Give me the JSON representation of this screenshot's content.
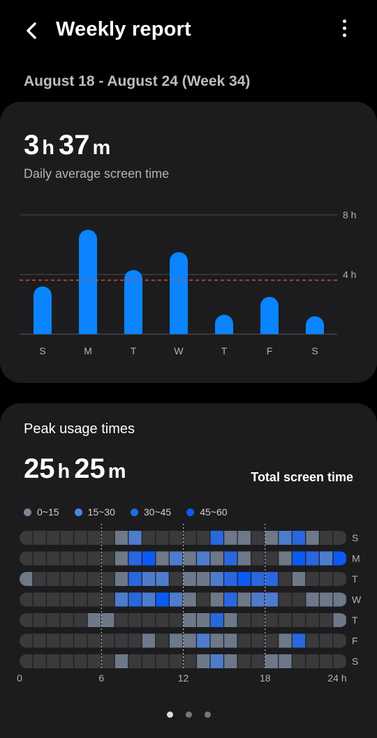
{
  "header": {
    "title": "Weekly report",
    "back_icon": "chevron-left-icon",
    "more_icon": "more-vertical-icon"
  },
  "date_range": "August 18 - August 24 (Week 34)",
  "summary": {
    "hours": "3",
    "hours_unit": "h",
    "minutes": "37",
    "minutes_unit": "m",
    "label": "Daily average screen time"
  },
  "chart_data": {
    "type": "bar",
    "categories": [
      "S",
      "M",
      "T",
      "W",
      "T",
      "F",
      "S"
    ],
    "values": [
      3.2,
      7.0,
      4.3,
      5.5,
      1.3,
      2.5,
      1.2
    ],
    "average": 3.62,
    "yticks": [
      "8 h",
      "4 h"
    ],
    "ylim": [
      0,
      8
    ],
    "bar_color": "#0a84ff",
    "average_line_color": "#e04848"
  },
  "peak": {
    "title": "Peak usage times",
    "hours": "25",
    "hours_unit": "h",
    "minutes": "25",
    "minutes_unit": "m",
    "total_label": "Total screen time",
    "legend": [
      {
        "label": "0~15",
        "color": "#7b8595"
      },
      {
        "label": "15~30",
        "color": "#4a86e8"
      },
      {
        "label": "30~45",
        "color": "#1c6fe0"
      },
      {
        "label": "45~60",
        "color": "#0a5cf5"
      }
    ],
    "days": [
      "S",
      "M",
      "T",
      "W",
      "T",
      "F",
      "S"
    ],
    "x_ticks": [
      "0",
      "6",
      "12",
      "18",
      "24 h"
    ],
    "level_colors": [
      "#3a3a3c",
      "#6d7889",
      "#4e7ccc",
      "#2a67de",
      "#0b5af2"
    ],
    "heatmap": [
      [
        0,
        0,
        0,
        0,
        0,
        0,
        0,
        1,
        2,
        0,
        0,
        0,
        0,
        0,
        3,
        1,
        1,
        0,
        1,
        2,
        3,
        1,
        0,
        0
      ],
      [
        0,
        0,
        0,
        0,
        0,
        0,
        0,
        1,
        3,
        4,
        1,
        2,
        1,
        2,
        1,
        3,
        1,
        0,
        0,
        1,
        4,
        3,
        2,
        4
      ],
      [
        1,
        0,
        0,
        0,
        0,
        0,
        0,
        1,
        3,
        2,
        2,
        0,
        1,
        1,
        2,
        3,
        4,
        3,
        3,
        0,
        1,
        0,
        0,
        0
      ],
      [
        0,
        0,
        0,
        0,
        0,
        0,
        0,
        2,
        3,
        2,
        4,
        2,
        1,
        0,
        1,
        3,
        1,
        2,
        2,
        0,
        0,
        1,
        1,
        1
      ],
      [
        0,
        0,
        0,
        0,
        0,
        1,
        1,
        0,
        0,
        0,
        0,
        0,
        1,
        1,
        3,
        1,
        0,
        0,
        0,
        0,
        0,
        0,
        0,
        1
      ],
      [
        0,
        0,
        0,
        0,
        0,
        0,
        0,
        0,
        0,
        1,
        0,
        1,
        1,
        2,
        1,
        1,
        0,
        0,
        0,
        1,
        3,
        0,
        0,
        0
      ],
      [
        0,
        0,
        0,
        0,
        0,
        0,
        0,
        1,
        0,
        0,
        0,
        0,
        0,
        1,
        2,
        1,
        0,
        0,
        1,
        1,
        0,
        0,
        0,
        0
      ]
    ]
  },
  "pager": {
    "count": 3,
    "active": 0
  }
}
